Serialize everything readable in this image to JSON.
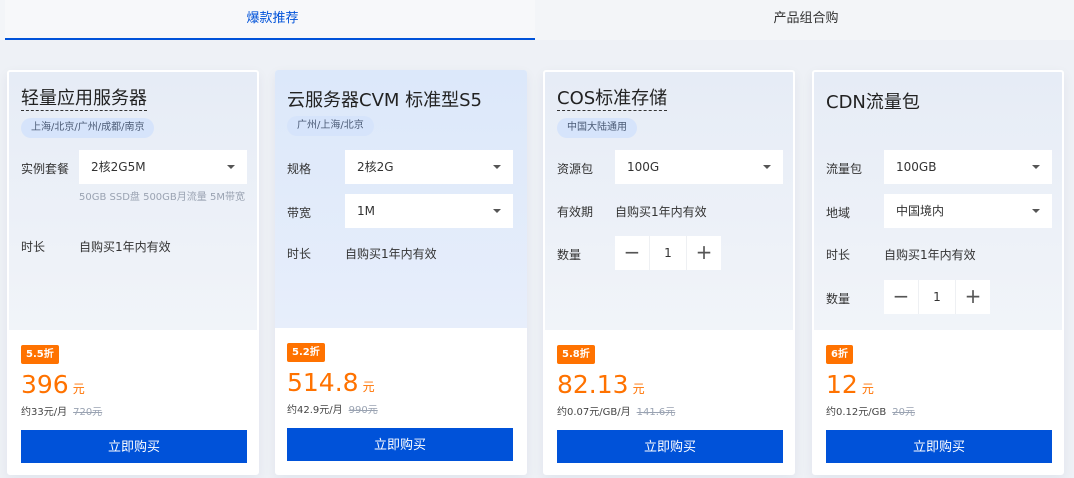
{
  "tabs": [
    {
      "label": "爆款推荐",
      "active": true
    },
    {
      "label": "产品组合购",
      "active": false
    }
  ],
  "cards": [
    {
      "title": "轻量应用服务器",
      "tag": "上海/北京/广州/成都/南京",
      "fields": {
        "plan_label": "实例套餐",
        "plan_value": "2核2G5M",
        "plan_note": "50GB SSD盘 500GB月流量 5M带宽",
        "duration_label": "时长",
        "duration_value": "自购买1年内有效"
      },
      "discount": "5.5折",
      "price": "396",
      "unit": "元",
      "per": "约33元/月",
      "original": "720元",
      "buy": "立即购买"
    },
    {
      "title": "云服务器CVM 标准型S5",
      "tag": "广州/上海/北京",
      "fields": {
        "spec_label": "规格",
        "spec_value": "2核2G",
        "bw_label": "带宽",
        "bw_value": "1M",
        "duration_label": "时长",
        "duration_value": "自购买1年内有效"
      },
      "discount": "5.2折",
      "price": "514.8",
      "unit": "元",
      "per": "约42.9元/月",
      "original": "990元",
      "buy": "立即购买"
    },
    {
      "title": "COS标准存储",
      "tag": "中国大陆通用",
      "fields": {
        "pack_label": "资源包",
        "pack_value": "100G",
        "valid_label": "有效期",
        "valid_value": "自购买1年内有效",
        "qty_label": "数量",
        "qty_value": "1"
      },
      "discount": "5.8折",
      "price": "82.13",
      "unit": "元",
      "per": "约0.07元/GB/月",
      "original": "141.6元",
      "buy": "立即购买"
    },
    {
      "title": "CDN流量包",
      "fields": {
        "pack_label": "流量包",
        "pack_value": "100GB",
        "region_label": "地域",
        "region_value": "中国境内",
        "duration_label": "时长",
        "duration_value": "自购买1年内有效",
        "qty_label": "数量",
        "qty_value": "1"
      },
      "discount": "6折",
      "price": "12",
      "unit": "元",
      "per": "约0.12元/GB",
      "original": "20元",
      "buy": "立即购买"
    }
  ],
  "colors": {
    "accent": "#0052d9",
    "price": "#ff7200"
  }
}
